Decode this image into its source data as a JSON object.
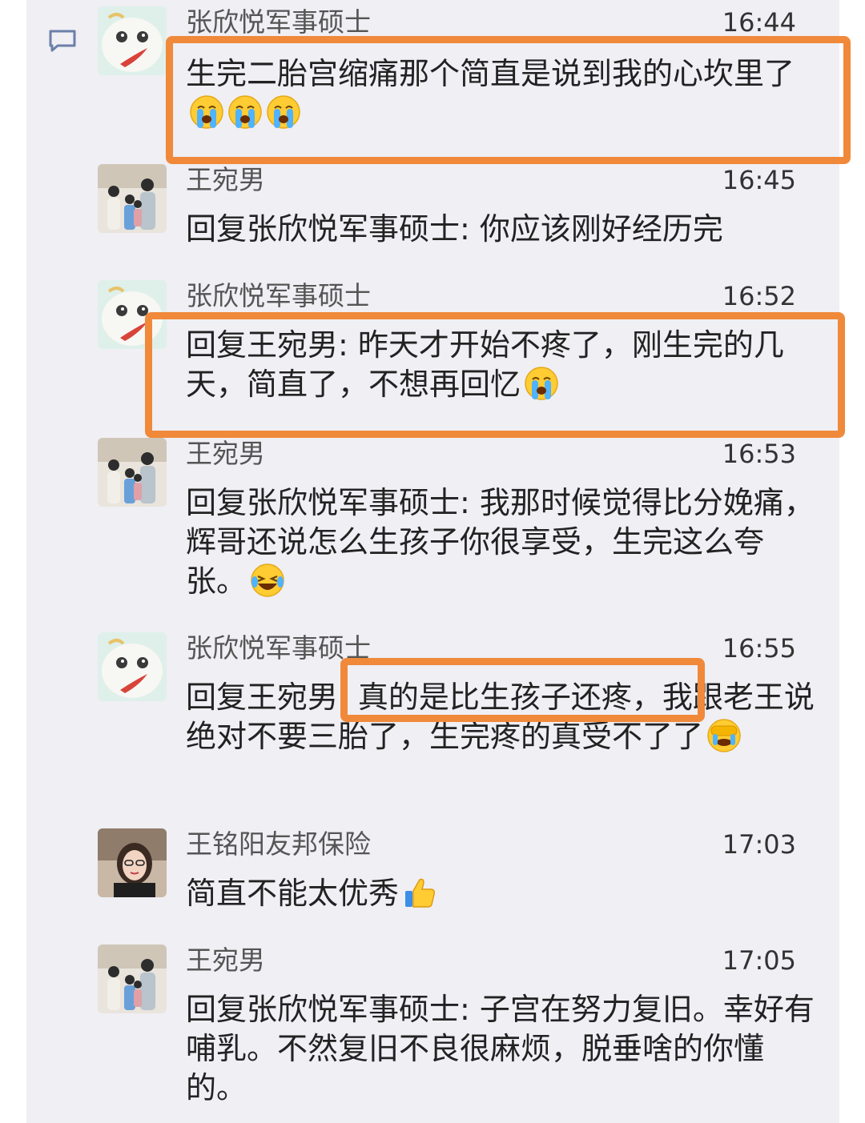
{
  "messages": [
    {
      "sender": "张欣悦军事硕士",
      "time": "16:44",
      "text": "生完二胎宫缩痛那个简直是说到我的心坎里了",
      "emojis": [
        "crying-emoji",
        "crying-emoji",
        "crying-emoji"
      ],
      "avatar": "cat-avatar"
    },
    {
      "sender": "王宛男",
      "time": "16:45",
      "text": "回复张欣悦军事硕士: 你应该刚好经历完",
      "emojis": [],
      "avatar": "family-avatar"
    },
    {
      "sender": "张欣悦军事硕士",
      "time": "16:52",
      "text": "回复王宛男: 昨天才开始不疼了，刚生完的几天，简直了，不想再回忆",
      "emojis": [
        "crying-emoji"
      ],
      "avatar": "cat-avatar"
    },
    {
      "sender": "王宛男",
      "time": "16:53",
      "text": "回复张欣悦军事硕士: 我那时候觉得比分娩痛，辉哥还说怎么生孩子你很享受，生完这么夸张。",
      "emojis": [
        "laughing-tears-emoji"
      ],
      "avatar": "family-avatar"
    },
    {
      "sender": "张欣悦军事硕士",
      "time": "16:55",
      "text": "回复王宛男: 真的是比生孩子还疼，我跟老王说绝对不要三胎了，生完疼的真受不了了",
      "emojis": [
        "facepalm-crying-emoji"
      ],
      "avatar": "cat-avatar"
    },
    {
      "sender": "王铭阳友邦保险",
      "time": "17:03",
      "text": "简直不能太优秀",
      "emojis": [
        "thumbs-up-emoji"
      ],
      "avatar": "woman-avatar"
    },
    {
      "sender": "王宛男",
      "time": "17:05",
      "text": "回复张欣悦军事硕士: 子宫在努力复旧。幸好有哺乳。不然复旧不良很麻烦，脱垂啥的你懂的。",
      "emojis": [],
      "avatar": "family-avatar"
    }
  ],
  "colors": {
    "highlight": "#f0893a",
    "panel": "#efeff4",
    "name": "#555555",
    "text": "#222222"
  }
}
